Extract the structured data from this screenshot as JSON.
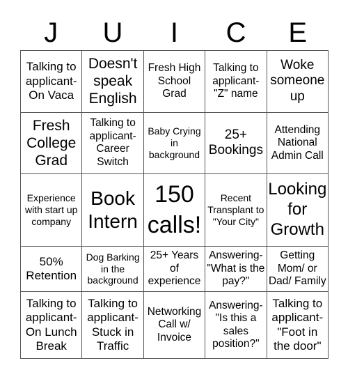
{
  "title_letters": [
    "J",
    "U",
    "I",
    "C",
    "E"
  ],
  "grid": [
    [
      "Talking to applicant- On Vaca",
      "Doesn't speak English",
      "Fresh High School Grad",
      "Talking to applicant- \"Z\" name",
      "Woke someone up"
    ],
    [
      "Fresh College Grad",
      "Talking to applicant- Career Switch",
      "Baby Crying in background",
      "25+ Bookings",
      "Attending National Admin Call"
    ],
    [
      "Experience with start up company",
      "Book Intern",
      "150 calls!",
      "Recent Transplant to \"Your City\"",
      "Looking for Growth"
    ],
    [
      "50% Retention",
      "Dog Barking in the background",
      "25+ Years of experience",
      "Answering- \"What is the pay?\"",
      "Getting Mom/ or Dad/ Family"
    ],
    [
      "Talking to applicant- On Lunch Break",
      "Talking to applicant- Stuck in Traffic",
      "Networking Call w/ Invoice",
      "Answering- \"Is this a sales position?\"",
      "Talking to applicant- \"Foot in the door\""
    ]
  ]
}
